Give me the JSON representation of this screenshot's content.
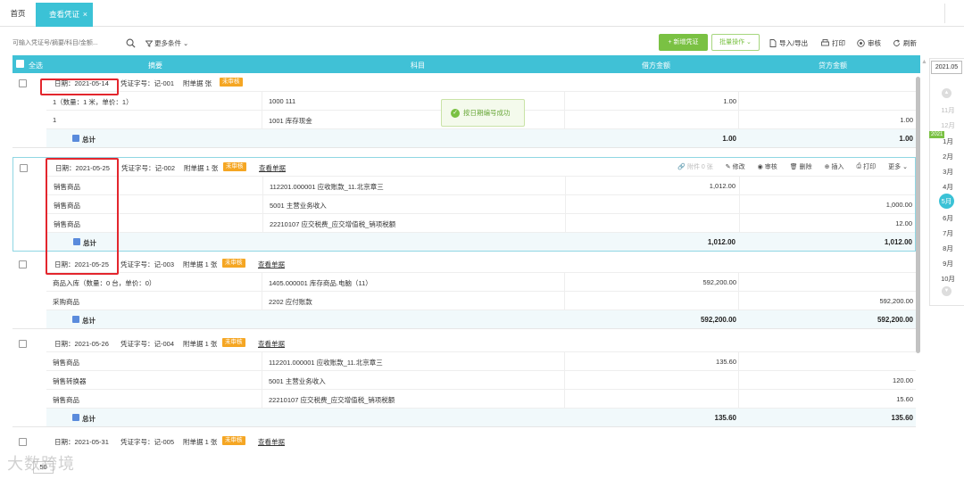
{
  "tabs": {
    "home": "首页",
    "active": "查看凭证",
    "close": "×"
  },
  "toolbar": {
    "search_placeholder": "可输入凭证号/摘要/科目/金额...",
    "more_filter": "更多条件",
    "new_voucher": "+ 新增凭证",
    "batch_ops": "批量操作",
    "import_export": "导入/导出",
    "print": "打印",
    "audit": "审核",
    "refresh": "刷新"
  },
  "table_header": {
    "select_all": "全选",
    "summary": "摘要",
    "account": "科目",
    "debit": "借方金额",
    "credit": "贷方金额"
  },
  "labels": {
    "total": "总计",
    "view_docs": "查看单据",
    "pending": "未审核"
  },
  "card_actions": {
    "attachment": "附件 0 张",
    "edit": "修改",
    "audit": "审核",
    "delete": "删除",
    "insert": "插入",
    "print": "打印",
    "more": "更多"
  },
  "toast": "按日期编号成功",
  "vouchers": [
    {
      "date": "日期：2021-05-14",
      "voucher_no": "凭证字号：记-001",
      "attachments": "附单据 张",
      "status": "未审核",
      "rows": [
        {
          "summary": "1（数量：1 米，单价：1）",
          "account": "1000 111",
          "debit": "1.00",
          "credit": ""
        },
        {
          "summary": "1",
          "account": "1001 库存现金",
          "debit": "",
          "credit": "1.00"
        }
      ],
      "total_debit": "1.00",
      "total_credit": "1.00"
    },
    {
      "date": "日期：2021-05-25",
      "voucher_no": "凭证字号：记-002",
      "attachments": "附单据 1 张",
      "status": "未审核",
      "rows": [
        {
          "summary": "销售商品",
          "account": "112201.000001 应收账款_11.北京章三",
          "debit": "1,012.00",
          "credit": ""
        },
        {
          "summary": "销售商品",
          "account": "5001 主营业务收入",
          "debit": "",
          "credit": "1,000.00"
        },
        {
          "summary": "销售商品",
          "account": "22210107 应交税费_应交增值税_销项税额",
          "debit": "",
          "credit": "12.00"
        }
      ],
      "total_debit": "1,012.00",
      "total_credit": "1,012.00"
    },
    {
      "date": "日期：2021-05-25",
      "voucher_no": "凭证字号：记-003",
      "attachments": "附单据 1 张",
      "status": "未审核",
      "rows": [
        {
          "summary": "商品入库（数量：0 台，单价：0）",
          "account": "1405.000001 库存商品.电脑（11）",
          "debit": "592,200.00",
          "credit": ""
        },
        {
          "summary": "采购商品",
          "account": "2202 应付账款",
          "debit": "",
          "credit": "592,200.00"
        }
      ],
      "total_debit": "592,200.00",
      "total_credit": "592,200.00"
    },
    {
      "date": "日期：2021-05-26",
      "voucher_no": "凭证字号：记-004",
      "attachments": "附单据 1 张",
      "status": "未审核",
      "rows": [
        {
          "summary": "销售商品",
          "account": "112201.000001 应收账款_11.北京章三",
          "debit": "135.60",
          "credit": ""
        },
        {
          "summary": "销售转换器",
          "account": "5001 主营业务收入",
          "debit": "",
          "credit": "120.00"
        },
        {
          "summary": "销售商品",
          "account": "22210107 应交税费_应交增值税_销项税额",
          "debit": "",
          "credit": "15.60"
        }
      ],
      "total_debit": "135.60",
      "total_credit": "135.60"
    },
    {
      "date": "日期：2021-05-31",
      "voucher_no": "凭证字号：记-005",
      "attachments": "附单据 1 张",
      "status": "未审核",
      "rows": [],
      "total_debit": "",
      "total_credit": ""
    }
  ],
  "period": {
    "current": "2021.05",
    "year_tag": "2021",
    "months": [
      "11月",
      "12月",
      "1月",
      "2月",
      "3月",
      "4月",
      "5月",
      "6月",
      "7月",
      "8月",
      "9月",
      "10月"
    ],
    "active_month": "5月"
  },
  "pagination": {
    "page_size": "50"
  },
  "watermark": "大数跨境"
}
